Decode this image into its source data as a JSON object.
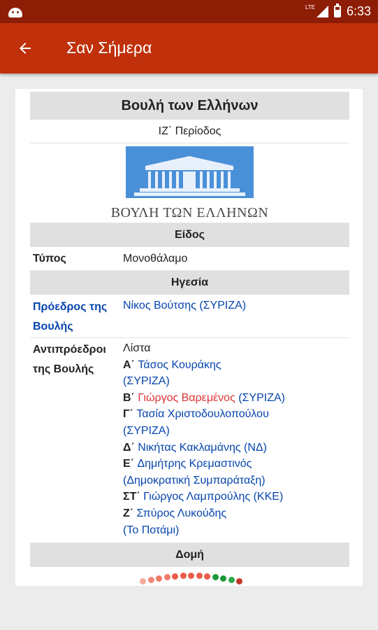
{
  "status_bar": {
    "network": "LTE",
    "time": "6:33",
    "icons": [
      "android-icon",
      "signal-icon",
      "battery-icon"
    ]
  },
  "app_bar": {
    "back_icon": "arrow-left-icon",
    "title": "Σαν Σήμερα"
  },
  "infobox": {
    "title": "Βουλή των Ελλήνων",
    "period": "ΙΖ΄ Περίοδος",
    "logo_caption": "ΒΟΥΛΗ ΤΩΝ ΕΛΛΗΝΩΝ",
    "section_type": "Είδος",
    "type_label": "Τύπος",
    "type_value": "Μονοθάλαμο",
    "section_leadership": "Ηγεσία",
    "president_label": "Πρόεδρος της Βουλής",
    "president_name": "Νίκος Βούτσης",
    "president_party": " (ΣΥΡΙΖΑ)",
    "vice_label": "Αντιπρόεδροι της Βουλής",
    "vice_list_label": "Λίστα",
    "vice_presidents": [
      {
        "ordinal": "Α΄",
        "name": "Τάσος Κουράκης",
        "party": "(ΣΥΡΙΖΑ)",
        "party_newline": true,
        "name_red": false
      },
      {
        "ordinal": "Β΄",
        "name": "Γιώργος Βαρεμένος",
        "party": " (ΣΥΡΙΖΑ)",
        "party_newline": false,
        "name_red": true
      },
      {
        "ordinal": "Γ΄",
        "name": "Τασία Χριστοδουλοπούλου",
        "party": "(ΣΥΡΙΖΑ)",
        "party_newline": true,
        "name_red": false
      },
      {
        "ordinal": "Δ΄",
        "name": "Νικήτας Κακλαμάνης",
        "party": " (ΝΔ)",
        "party_newline": false,
        "name_red": false
      },
      {
        "ordinal": "Ε΄",
        "name": "Δημήτρης Κρεμαστινός",
        "party": "(Δημοκρατική Συμπαράταξη)",
        "party_newline": true,
        "name_red": false
      },
      {
        "ordinal": "ΣΤ΄",
        "name": "Γιώργος Λαμπρούλης",
        "party": " (ΚΚΕ)",
        "party_newline": false,
        "name_red": false
      },
      {
        "ordinal": "Ζ΄",
        "name": "Σπύρος Λυκούδης",
        "party": "(Το Ποτάμι)",
        "party_newline": true,
        "name_red": false
      }
    ],
    "section_structure": "Δομή"
  },
  "colors": {
    "status_bar": "#8e1d06",
    "app_bar": "#c0300a",
    "link": "#0645ad",
    "red_link": "#dd3333",
    "header_bg": "#e0e0e0",
    "logo_blue": "#4a90d9"
  }
}
